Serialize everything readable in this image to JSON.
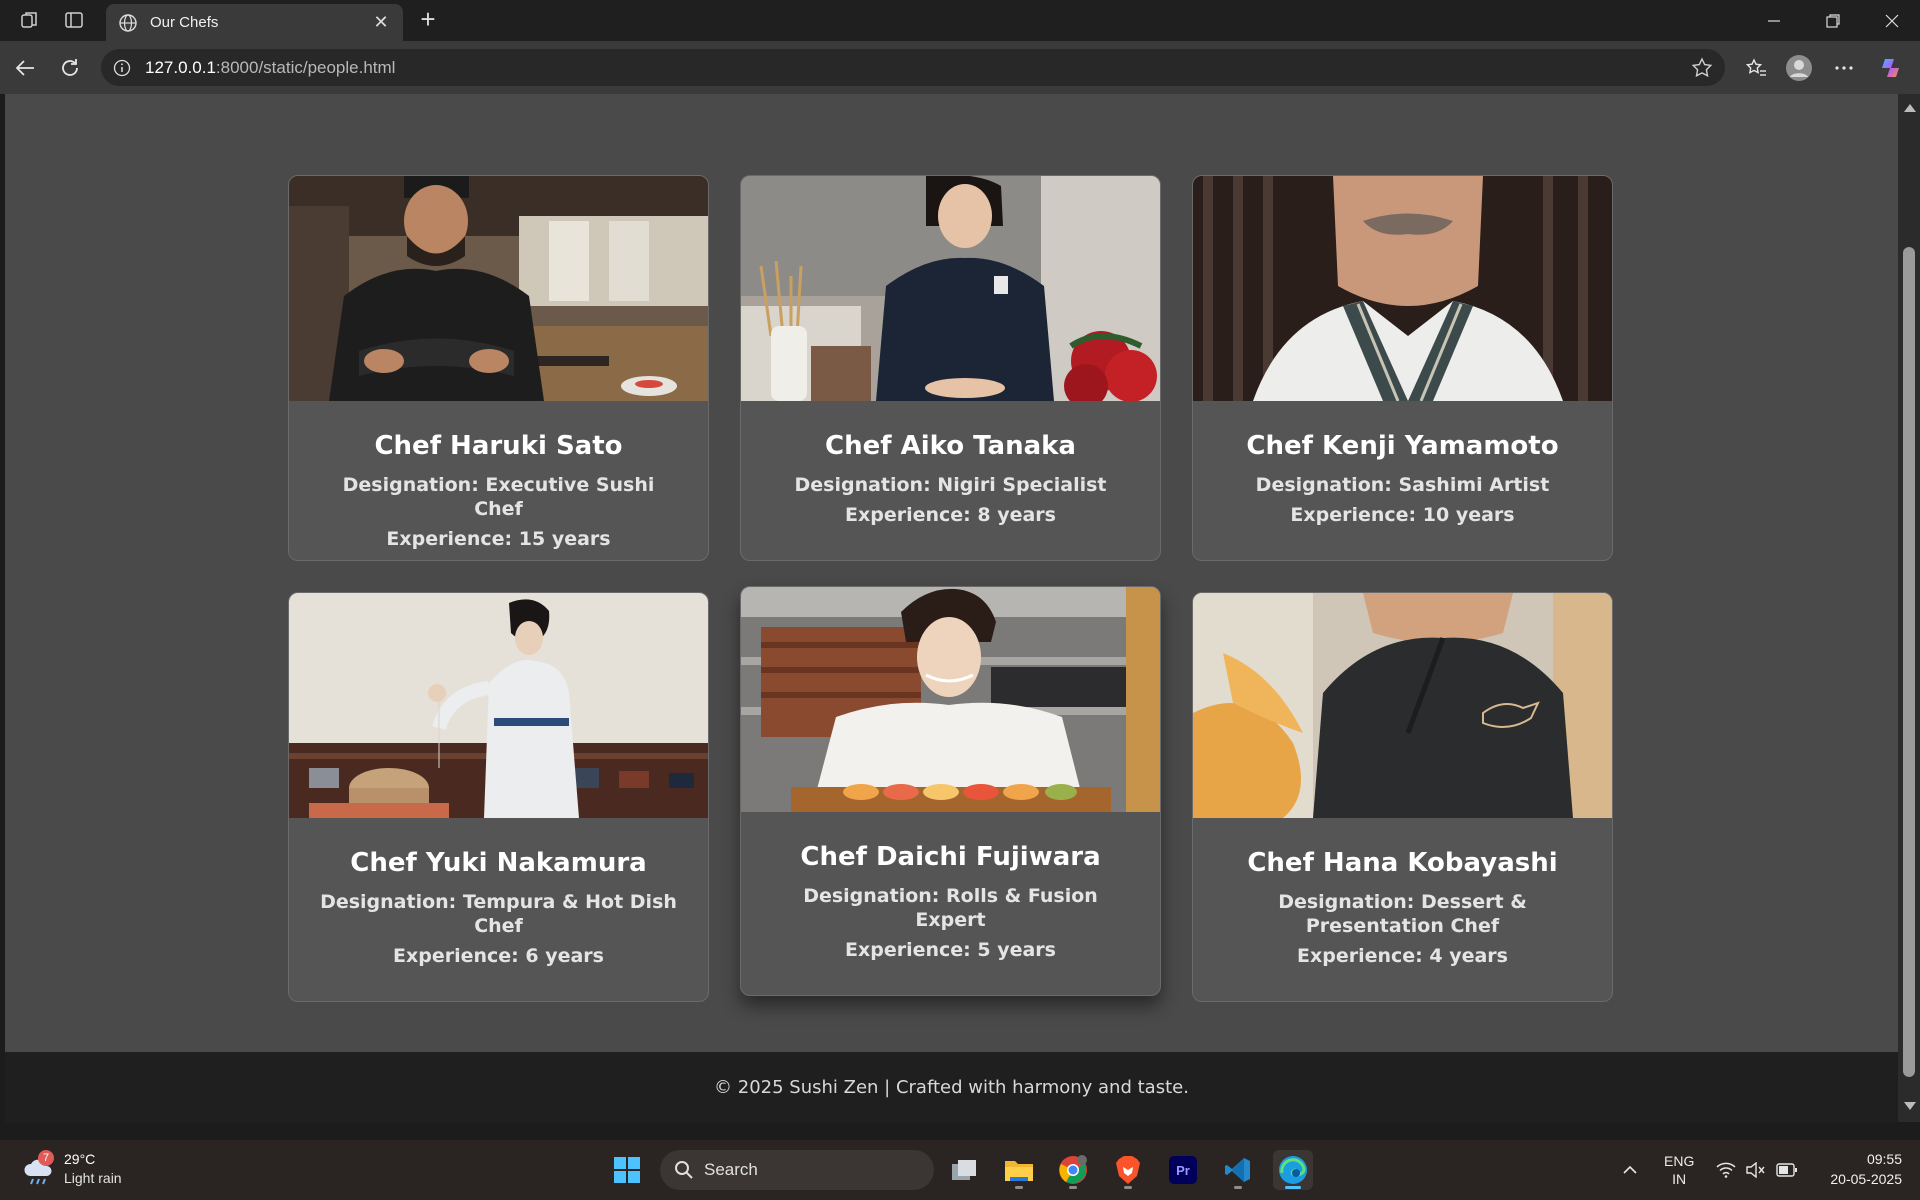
{
  "browser": {
    "tab_title": "Our Chefs",
    "url_host": "127.0.0.1",
    "url_path": ":8000/static/people.html"
  },
  "chefs": [
    {
      "name": "Chef Haruki Sato",
      "designation": "Designation: Executive Sushi Chef",
      "experience": "Experience: 15 years"
    },
    {
      "name": "Chef Aiko Tanaka",
      "designation": "Designation: Nigiri Specialist",
      "experience": "Experience: 8 years"
    },
    {
      "name": "Chef Kenji Yamamoto",
      "designation": "Designation: Sashimi Artist",
      "experience": "Experience: 10 years"
    },
    {
      "name": "Chef Yuki Nakamura",
      "designation": "Designation: Tempura & Hot Dish Chef",
      "experience": "Experience: 6 years"
    },
    {
      "name": "Chef Daichi Fujiwara",
      "designation": "Designation: Rolls & Fusion Expert",
      "experience": "Experience: 5 years"
    },
    {
      "name": "Chef Hana Kobayashi",
      "designation": "Designation: Dessert & Presentation Chef",
      "experience": "Experience: 4 years"
    }
  ],
  "footer": {
    "text": "© 2025 Sushi Zen | Crafted with harmony and taste."
  },
  "taskbar": {
    "weather_temp": "29°C",
    "weather_cond": "Light rain",
    "weather_badge": "7",
    "search_label": "Search",
    "lang_top": "ENG",
    "lang_bottom": "IN",
    "time": "09:55",
    "date": "20-05-2025"
  }
}
